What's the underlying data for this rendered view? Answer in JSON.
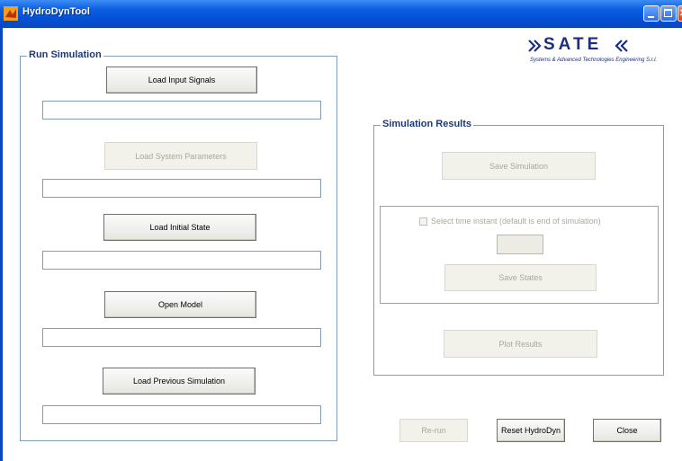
{
  "window": {
    "title": "HydroDynTool"
  },
  "logo": {
    "text": "SATE",
    "subtitle": "Systems & Advanced Technologies Engineering S.r.l."
  },
  "run_simulation": {
    "title": "Run Simulation",
    "load_input_label": "Load Input Signals",
    "load_params_label": "Load System Parameters",
    "load_initial_label": "Load Initial State",
    "open_model_label": "Open Model",
    "load_prev_label": "Load Previous Simulation"
  },
  "simulation_results": {
    "title": "Simulation Results",
    "save_simulation_label": "Save Simulation",
    "checkbox_label": "Select time instant (default is end of simulation)",
    "save_states_label": "Save States",
    "plot_results_label": "Plot Results"
  },
  "bottom": {
    "rerun_label": "Re-run",
    "reset_label": "Reset HydroDyn",
    "close_label": "Close"
  },
  "colors": {
    "titlebar": "#0451d6",
    "panel_title": "#1a3a7a",
    "logo": "#1b2e86"
  }
}
